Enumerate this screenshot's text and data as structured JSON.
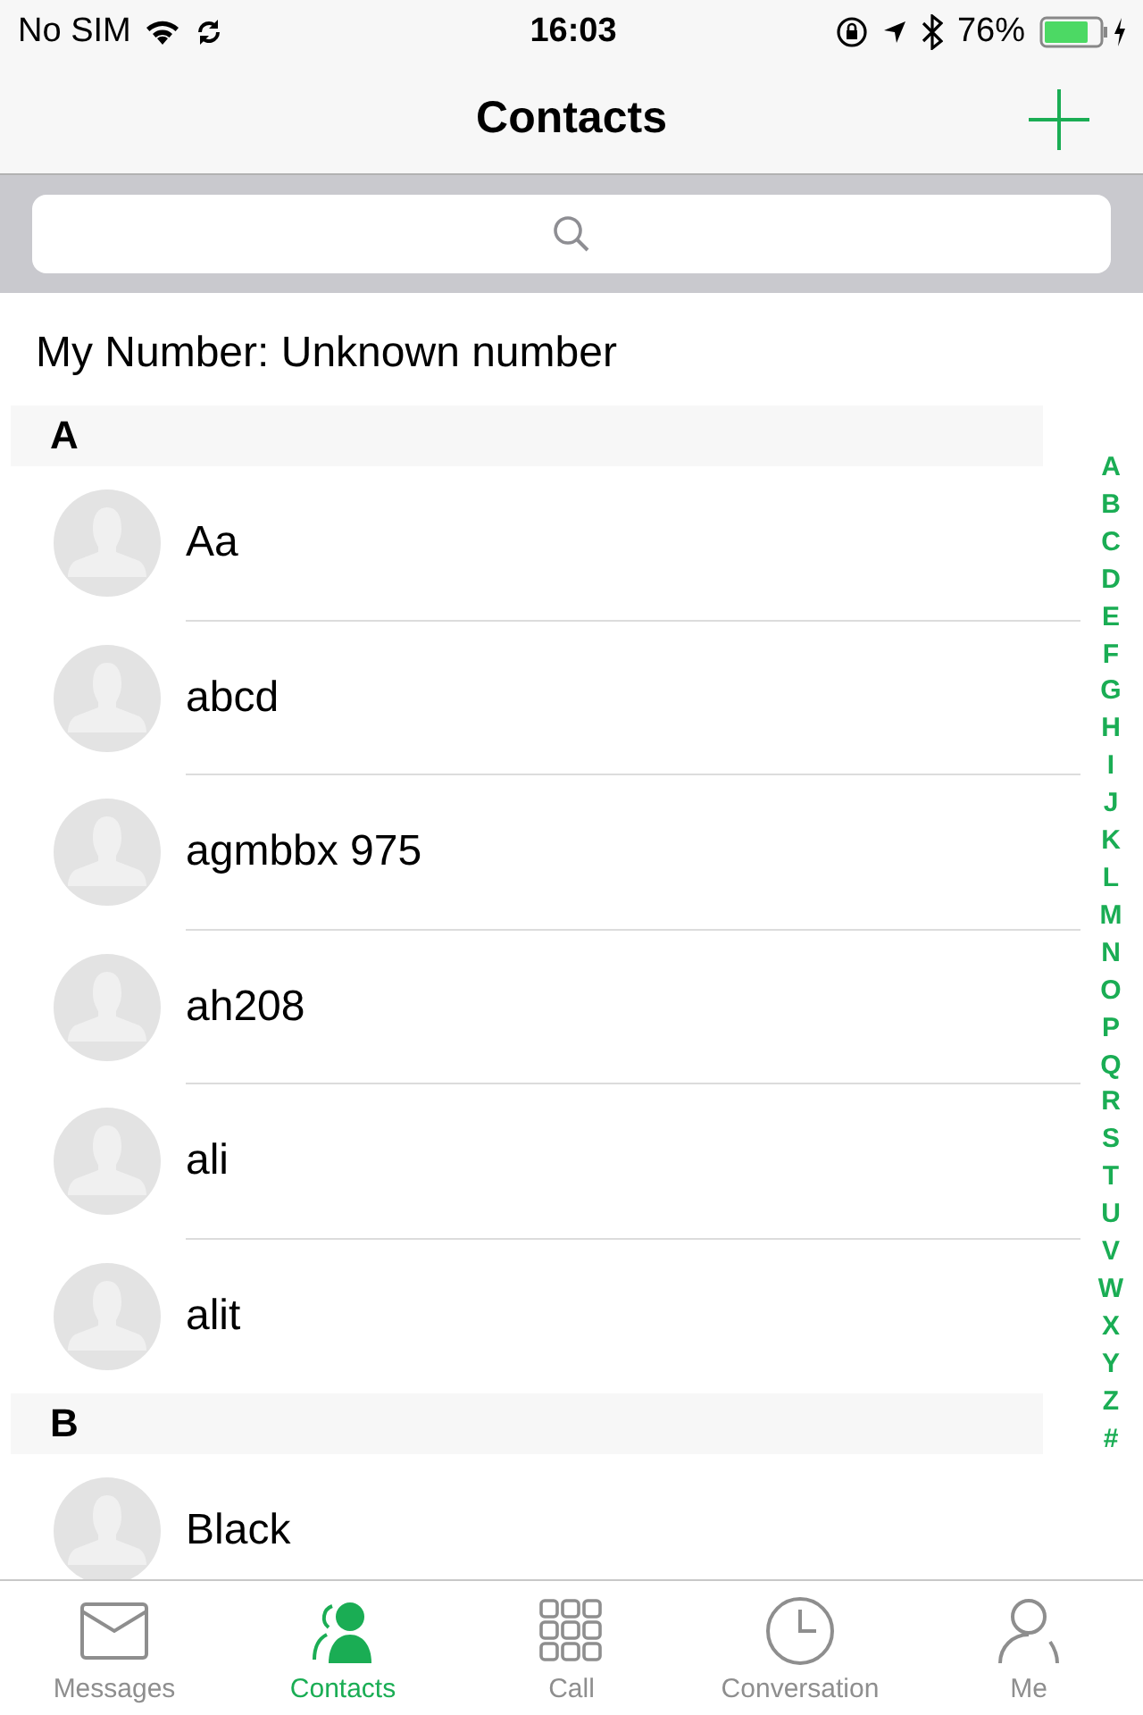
{
  "status_bar": {
    "carrier": "No SIM",
    "time": "16:03",
    "battery": "76%"
  },
  "nav": {
    "title": "Contacts"
  },
  "my_number": "My Number: Unknown number",
  "sections": [
    {
      "letter": "A",
      "contacts": [
        "Aa",
        "abcd",
        "agmbbx 975",
        "ah208",
        "ali",
        "alit"
      ]
    },
    {
      "letter": "B",
      "contacts": [
        "Black"
      ]
    }
  ],
  "index": [
    "A",
    "B",
    "C",
    "D",
    "E",
    "F",
    "G",
    "H",
    "I",
    "J",
    "K",
    "L",
    "M",
    "N",
    "O",
    "P",
    "Q",
    "R",
    "S",
    "T",
    "U",
    "V",
    "W",
    "X",
    "Y",
    "Z",
    "#"
  ],
  "tabs": [
    {
      "kind": "messages",
      "label": "Messages",
      "selected": false
    },
    {
      "kind": "contacts",
      "label": "Contacts",
      "selected": true
    },
    {
      "kind": "call",
      "label": "Call",
      "selected": false
    },
    {
      "kind": "conversation",
      "label": "Conversation",
      "selected": false
    },
    {
      "kind": "me",
      "label": "Me",
      "selected": false
    }
  ]
}
